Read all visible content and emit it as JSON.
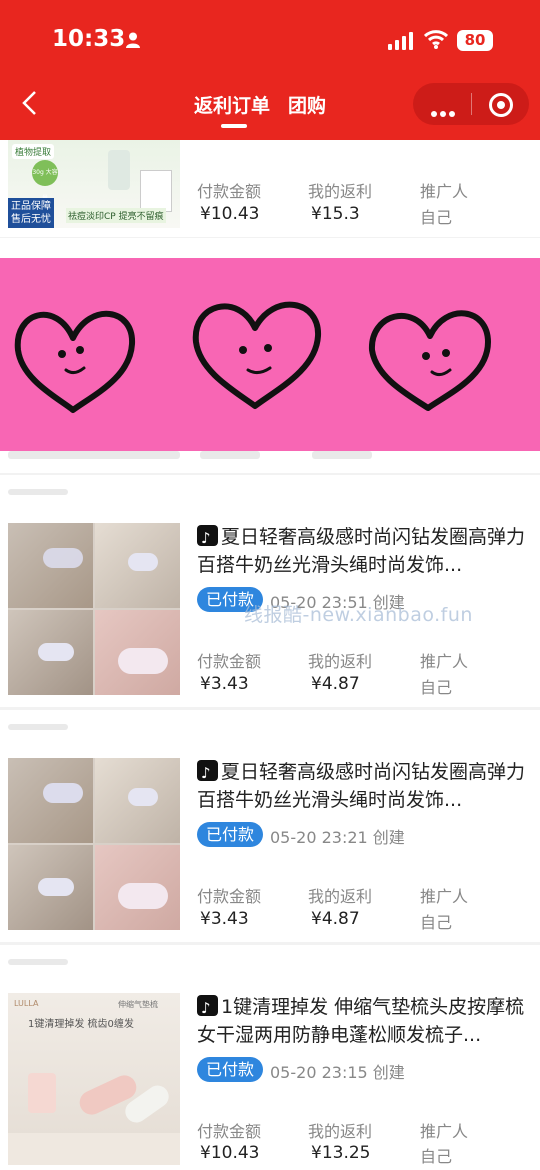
{
  "status": {
    "time": "10:33",
    "battery": "80"
  },
  "nav": {
    "title": "返利订单",
    "title2": "团购"
  },
  "top_card": {
    "promo_lines": [
      "植物提取",
      "30g 大容量",
      "正品保障",
      "售后无忧",
      "祛痘淡印CP 提亮不留痕"
    ],
    "pay_label": "付款金额",
    "pay_value": "¥10.43",
    "rebate_label": "我的返利",
    "rebate_value": "¥15.3",
    "promoter_label": "推广人",
    "promoter_value": "自己"
  },
  "orders": [
    {
      "title": "夏日轻奢高级感时尚闪钻发圈高弹力百搭牛奶丝光滑头绳时尚发饰...",
      "status": "已付款",
      "date": "05-20 23:51 创建",
      "pay_label": "付款金额",
      "pay_value": "¥3.43",
      "rebate_label": "我的返利",
      "rebate_value": "¥4.87",
      "promoter_label": "推广人",
      "promoter_value": "自己"
    },
    {
      "title": "夏日轻奢高级感时尚闪钻发圈高弹力百搭牛奶丝光滑头绳时尚发饰...",
      "status": "已付款",
      "date": "05-20 23:21 创建",
      "pay_label": "付款金额",
      "pay_value": "¥3.43",
      "rebate_label": "我的返利",
      "rebate_value": "¥4.87",
      "promoter_label": "推广人",
      "promoter_value": "自己"
    },
    {
      "title": "1键清理掉发 伸缩气垫梳头皮按摩梳女干湿两用防静电蓬松顺发梳子...",
      "status": "已付款",
      "date": "05-20 23:15 创建",
      "pay_label": "付款金额",
      "pay_value": "¥10.43",
      "rebate_label": "我的返利",
      "rebate_value": "¥13.25",
      "promoter_label": "推广人",
      "promoter_value": "自己",
      "product_text": [
        "LULLA",
        "1键清理掉发 梳齿0缠发",
        "伸缩气垫梳"
      ]
    }
  ],
  "watermark": "线报酷-new.xianbao.fun",
  "colors": {
    "brand": "#e8261f",
    "badge": "#2e86de",
    "overlay": "#f866b4"
  }
}
